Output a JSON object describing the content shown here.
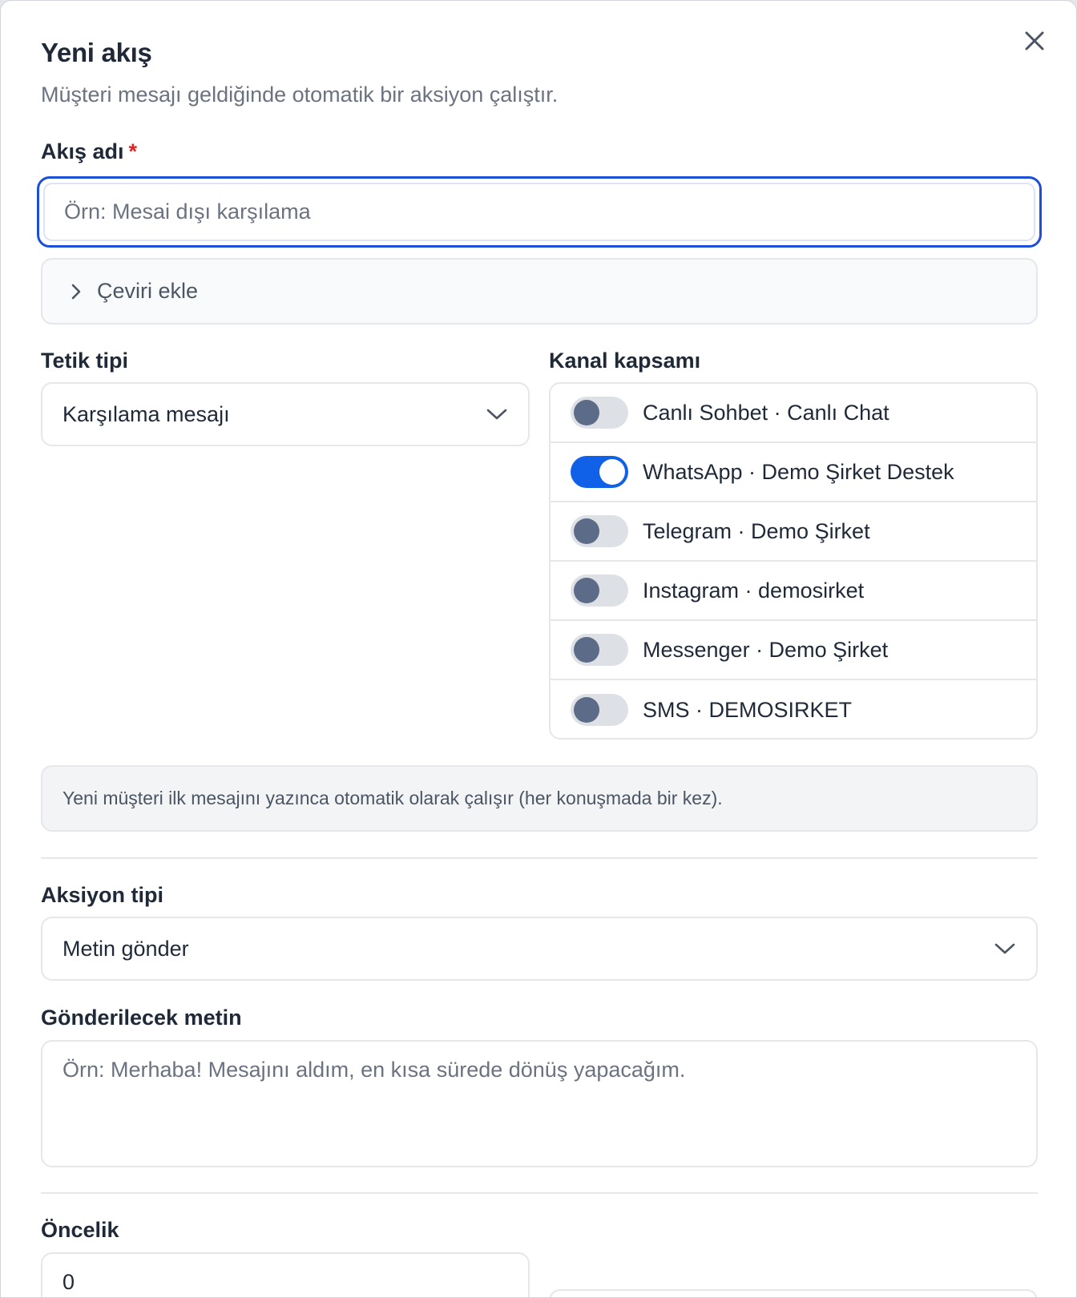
{
  "dialog": {
    "title": "Yeni akış",
    "subtitle": "Müşteri mesajı geldiğinde otomatik bir aksiyon çalıştır."
  },
  "flow_name": {
    "label": "Akış adı",
    "required_mark": "*",
    "placeholder": "Örn: Mesai dışı karşılama",
    "value": ""
  },
  "translation": {
    "label": "Çeviri ekle",
    "icon": "chevron-right-icon"
  },
  "trigger": {
    "label": "Tetik tipi",
    "selected": "Karşılama mesajı",
    "info": "Yeni müşteri ilk mesajını yazınca otomatik olarak çalışır (her konuşmada bir kez)."
  },
  "channel_scope": {
    "label": "Kanal kapsamı",
    "channels": [
      {
        "label": "Canlı Sohbet · Canlı Chat",
        "enabled": false
      },
      {
        "label": "WhatsApp · Demo Şirket Destek",
        "enabled": true
      },
      {
        "label": "Telegram · Demo Şirket",
        "enabled": false
      },
      {
        "label": "Instagram · demosirket",
        "enabled": false
      },
      {
        "label": "Messenger · Demo Şirket",
        "enabled": false
      },
      {
        "label": "SMS · DEMOSIRKET",
        "enabled": false
      }
    ]
  },
  "action": {
    "label": "Aksiyon tipi",
    "selected": "Metin gönder"
  },
  "message": {
    "label": "Gönderilecek metin",
    "placeholder": "Örn: Merhaba! Mesajını aldım, en kısa sürede dönüş yapacağım.",
    "value": ""
  },
  "priority": {
    "label": "Öncelik",
    "value": "0"
  },
  "colors": {
    "accent": "#1d4ed8",
    "toggle_on": "#1160e8",
    "toggle_off_knob": "#5b6b88",
    "required": "#dc2626"
  }
}
